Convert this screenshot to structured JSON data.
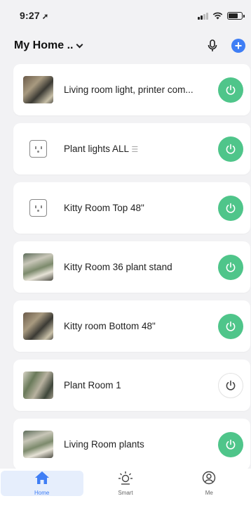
{
  "status_bar": {
    "time": "9:27",
    "location_glyph": "➚"
  },
  "header": {
    "title": "My Home ..",
    "add_label": "+"
  },
  "devices": [
    {
      "name": "Living room light, printer com...",
      "state": "on",
      "thumb": "photo"
    },
    {
      "name": "Plant lights ALL",
      "group_mark": "☰",
      "state": "on",
      "thumb": "plug"
    },
    {
      "name": "Kitty Room Top 48\"",
      "state": "on",
      "thumb": "plug"
    },
    {
      "name": "Kitty Room 36 plant stand",
      "state": "on",
      "thumb": "photo2"
    },
    {
      "name": "Kitty room  Bottom 48\"",
      "state": "on",
      "thumb": "photo"
    },
    {
      "name": "Plant Room 1",
      "state": "off",
      "thumb": "photo3"
    },
    {
      "name": "Living Room plants",
      "state": "on",
      "thumb": "photo2"
    }
  ],
  "tabs": [
    {
      "label": "Home",
      "icon": "home-icon",
      "active": true
    },
    {
      "label": "Smart",
      "icon": "sun-icon",
      "active": false
    },
    {
      "label": "Me",
      "icon": "user-icon",
      "active": false
    }
  ],
  "colors": {
    "accent": "#3f7ef5",
    "power_on": "#4fc58a",
    "background": "#f2f2f4"
  }
}
